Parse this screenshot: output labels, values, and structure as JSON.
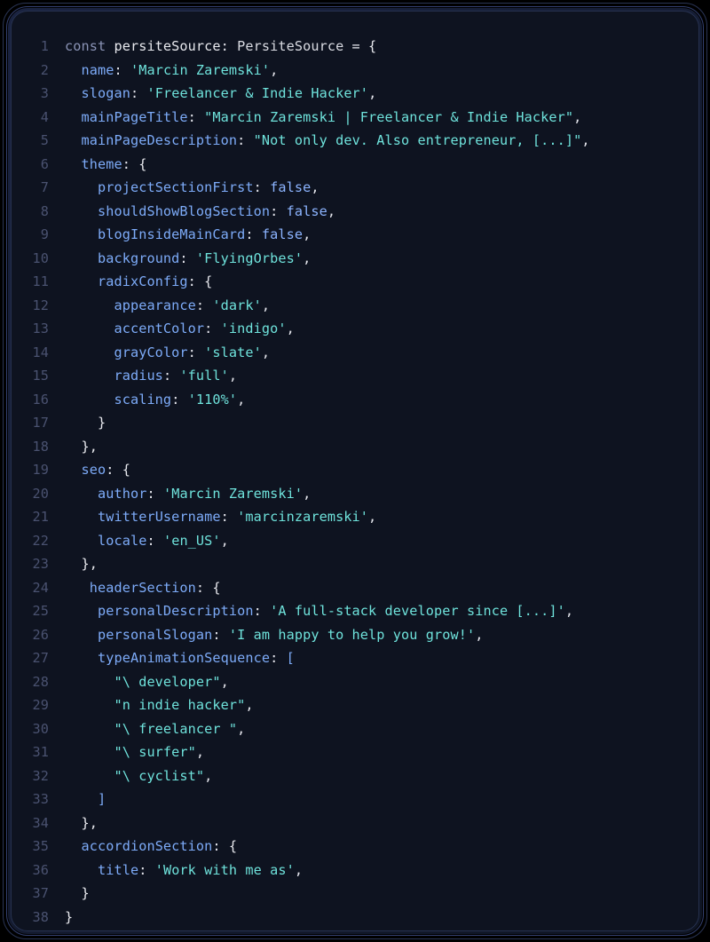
{
  "lines": [
    {
      "n": "1",
      "segs": [
        [
          "c-kw",
          "const "
        ],
        [
          "c-id",
          "persiteSource"
        ],
        [
          "c-punc",
          ": "
        ],
        [
          "c-type",
          "PersiteSource"
        ],
        [
          "c-punc",
          " = "
        ],
        [
          "c-id",
          "{"
        ]
      ]
    },
    {
      "n": "2",
      "segs": [
        [
          "c-id",
          "  "
        ],
        [
          "c-prop",
          "name"
        ],
        [
          "c-punc",
          ": "
        ],
        [
          "c-str",
          "'Marcin Zaremski'"
        ],
        [
          "c-punc",
          ","
        ]
      ]
    },
    {
      "n": "3",
      "segs": [
        [
          "c-id",
          "  "
        ],
        [
          "c-prop",
          "slogan"
        ],
        [
          "c-punc",
          ": "
        ],
        [
          "c-str",
          "'Freelancer & Indie Hacker'"
        ],
        [
          "c-punc",
          ","
        ]
      ]
    },
    {
      "n": "4",
      "segs": [
        [
          "c-id",
          "  "
        ],
        [
          "c-prop",
          "mainPageTitle"
        ],
        [
          "c-punc",
          ": "
        ],
        [
          "c-str",
          "\"Marcin Zaremski | Freelancer & Indie Hacker\""
        ],
        [
          "c-punc",
          ","
        ]
      ]
    },
    {
      "n": "5",
      "segs": [
        [
          "c-id",
          "  "
        ],
        [
          "c-prop",
          "mainPageDescription"
        ],
        [
          "c-punc",
          ": "
        ],
        [
          "c-str",
          "\"Not only dev. Also entrepreneur, [...]\""
        ],
        [
          "c-punc",
          ","
        ]
      ]
    },
    {
      "n": "6",
      "segs": [
        [
          "c-id",
          "  "
        ],
        [
          "c-prop",
          "theme"
        ],
        [
          "c-punc",
          ": "
        ],
        [
          "c-id",
          "{"
        ]
      ]
    },
    {
      "n": "7",
      "segs": [
        [
          "c-id",
          "    "
        ],
        [
          "c-prop",
          "projectSectionFirst"
        ],
        [
          "c-punc",
          ": "
        ],
        [
          "c-bool",
          "false"
        ],
        [
          "c-punc",
          ","
        ]
      ]
    },
    {
      "n": "8",
      "segs": [
        [
          "c-id",
          "    "
        ],
        [
          "c-prop",
          "shouldShowBlogSection"
        ],
        [
          "c-punc",
          ": "
        ],
        [
          "c-bool",
          "false"
        ],
        [
          "c-punc",
          ","
        ]
      ]
    },
    {
      "n": "9",
      "segs": [
        [
          "c-id",
          "    "
        ],
        [
          "c-prop",
          "blogInsideMainCard"
        ],
        [
          "c-punc",
          ": "
        ],
        [
          "c-bool",
          "false"
        ],
        [
          "c-punc",
          ","
        ]
      ]
    },
    {
      "n": "10",
      "segs": [
        [
          "c-id",
          "    "
        ],
        [
          "c-prop",
          "background"
        ],
        [
          "c-punc",
          ": "
        ],
        [
          "c-str",
          "'FlyingOrbes'"
        ],
        [
          "c-punc",
          ","
        ]
      ]
    },
    {
      "n": "11",
      "segs": [
        [
          "c-id",
          "    "
        ],
        [
          "c-prop",
          "radixConfig"
        ],
        [
          "c-punc",
          ": "
        ],
        [
          "c-id",
          "{"
        ]
      ]
    },
    {
      "n": "12",
      "segs": [
        [
          "c-id",
          "      "
        ],
        [
          "c-prop",
          "appearance"
        ],
        [
          "c-punc",
          ": "
        ],
        [
          "c-str",
          "'dark'"
        ],
        [
          "c-punc",
          ","
        ]
      ]
    },
    {
      "n": "13",
      "segs": [
        [
          "c-id",
          "      "
        ],
        [
          "c-prop",
          "accentColor"
        ],
        [
          "c-punc",
          ": "
        ],
        [
          "c-str",
          "'indigo'"
        ],
        [
          "c-punc",
          ","
        ]
      ]
    },
    {
      "n": "14",
      "segs": [
        [
          "c-id",
          "      "
        ],
        [
          "c-prop",
          "grayColor"
        ],
        [
          "c-punc",
          ": "
        ],
        [
          "c-str",
          "'slate'"
        ],
        [
          "c-punc",
          ","
        ]
      ]
    },
    {
      "n": "15",
      "segs": [
        [
          "c-id",
          "      "
        ],
        [
          "c-prop",
          "radius"
        ],
        [
          "c-punc",
          ": "
        ],
        [
          "c-str",
          "'full'"
        ],
        [
          "c-punc",
          ","
        ]
      ]
    },
    {
      "n": "16",
      "segs": [
        [
          "c-id",
          "      "
        ],
        [
          "c-prop",
          "scaling"
        ],
        [
          "c-punc",
          ": "
        ],
        [
          "c-str",
          "'110%'"
        ],
        [
          "c-punc",
          ","
        ]
      ]
    },
    {
      "n": "17",
      "segs": [
        [
          "c-id",
          "    }"
        ]
      ]
    },
    {
      "n": "18",
      "segs": [
        [
          "c-id",
          "  },"
        ]
      ]
    },
    {
      "n": "19",
      "segs": [
        [
          "c-id",
          "  "
        ],
        [
          "c-prop",
          "seo"
        ],
        [
          "c-punc",
          ": "
        ],
        [
          "c-id",
          "{"
        ]
      ]
    },
    {
      "n": "20",
      "segs": [
        [
          "c-id",
          "    "
        ],
        [
          "c-prop",
          "author"
        ],
        [
          "c-punc",
          ": "
        ],
        [
          "c-str",
          "'Marcin Zaremski'"
        ],
        [
          "c-punc",
          ","
        ]
      ]
    },
    {
      "n": "21",
      "segs": [
        [
          "c-id",
          "    "
        ],
        [
          "c-prop",
          "twitterUsername"
        ],
        [
          "c-punc",
          ": "
        ],
        [
          "c-str",
          "'marcinzaremski'"
        ],
        [
          "c-punc",
          ","
        ]
      ]
    },
    {
      "n": "22",
      "segs": [
        [
          "c-id",
          "    "
        ],
        [
          "c-prop",
          "locale"
        ],
        [
          "c-punc",
          ": "
        ],
        [
          "c-str",
          "'en_US'"
        ],
        [
          "c-punc",
          ","
        ]
      ]
    },
    {
      "n": "23",
      "segs": [
        [
          "c-id",
          "  },"
        ]
      ]
    },
    {
      "n": "24",
      "segs": [
        [
          "c-id",
          "   "
        ],
        [
          "c-prop",
          "headerSection"
        ],
        [
          "c-punc",
          ": "
        ],
        [
          "c-id",
          "{"
        ]
      ]
    },
    {
      "n": "25",
      "segs": [
        [
          "c-id",
          "    "
        ],
        [
          "c-prop",
          "personalDescription"
        ],
        [
          "c-punc",
          ": "
        ],
        [
          "c-str",
          "'A full-stack developer since [...]'"
        ],
        [
          "c-punc",
          ","
        ]
      ]
    },
    {
      "n": "26",
      "segs": [
        [
          "c-id",
          "    "
        ],
        [
          "c-prop",
          "personalSlogan"
        ],
        [
          "c-punc",
          ": "
        ],
        [
          "c-str",
          "'I am happy to help you grow!'"
        ],
        [
          "c-punc",
          ","
        ]
      ]
    },
    {
      "n": "27",
      "segs": [
        [
          "c-id",
          "    "
        ],
        [
          "c-prop",
          "typeAnimationSequence"
        ],
        [
          "c-punc",
          ": "
        ],
        [
          "c-brack",
          "["
        ]
      ]
    },
    {
      "n": "28",
      "segs": [
        [
          "c-id",
          "      "
        ],
        [
          "c-str",
          "\"\\ developer\""
        ],
        [
          "c-punc",
          ","
        ]
      ]
    },
    {
      "n": "29",
      "segs": [
        [
          "c-id",
          "      "
        ],
        [
          "c-str",
          "\"n indie hacker\""
        ],
        [
          "c-punc",
          ","
        ]
      ]
    },
    {
      "n": "30",
      "segs": [
        [
          "c-id",
          "      "
        ],
        [
          "c-str",
          "\"\\ freelancer \""
        ],
        [
          "c-punc",
          ","
        ]
      ]
    },
    {
      "n": "31",
      "segs": [
        [
          "c-id",
          "      "
        ],
        [
          "c-str",
          "\"\\ surfer\""
        ],
        [
          "c-punc",
          ","
        ]
      ]
    },
    {
      "n": "32",
      "segs": [
        [
          "c-id",
          "      "
        ],
        [
          "c-str",
          "\"\\ cyclist\""
        ],
        [
          "c-punc",
          ","
        ]
      ]
    },
    {
      "n": "33",
      "segs": [
        [
          "c-id",
          "    "
        ],
        [
          "c-brack",
          "]"
        ]
      ]
    },
    {
      "n": "34",
      "segs": [
        [
          "c-id",
          "  },"
        ]
      ]
    },
    {
      "n": "35",
      "segs": [
        [
          "c-id",
          "  "
        ],
        [
          "c-prop",
          "accordionSection"
        ],
        [
          "c-punc",
          ": "
        ],
        [
          "c-id",
          "{"
        ]
      ]
    },
    {
      "n": "36",
      "segs": [
        [
          "c-id",
          "    "
        ],
        [
          "c-prop",
          "title"
        ],
        [
          "c-punc",
          ": "
        ],
        [
          "c-str",
          "'Work with me as'"
        ],
        [
          "c-punc",
          ","
        ]
      ]
    },
    {
      "n": "37",
      "segs": [
        [
          "c-id",
          "  }"
        ]
      ]
    },
    {
      "n": "38",
      "segs": [
        [
          "c-id",
          "}"
        ]
      ]
    }
  ]
}
